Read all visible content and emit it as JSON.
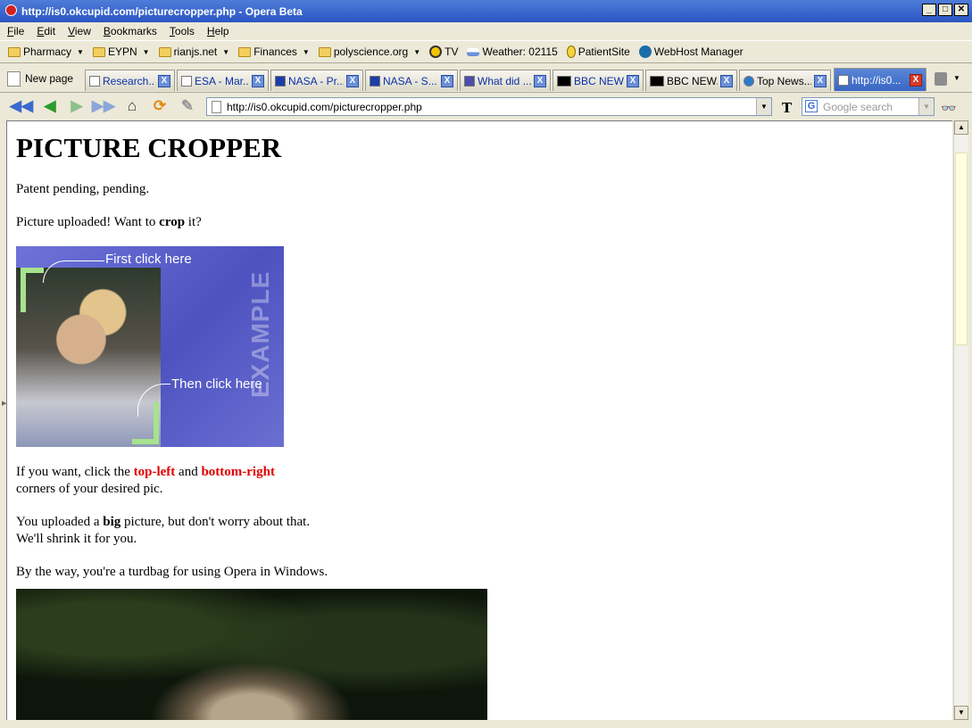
{
  "window": {
    "title": "http://is0.okcupid.com/picturecropper.php - Opera Beta",
    "buttons": {
      "minimize": "_",
      "maximize": "□",
      "close": "✕"
    }
  },
  "menu": [
    "File",
    "Edit",
    "View",
    "Bookmarks",
    "Tools",
    "Help"
  ],
  "bookmarks": [
    {
      "label": "Pharmacy",
      "type": "folder",
      "dropdown": true
    },
    {
      "label": "EYPN",
      "type": "folder",
      "dropdown": true
    },
    {
      "label": "rianjs.net",
      "type": "folder",
      "dropdown": true
    },
    {
      "label": "Finances",
      "type": "folder",
      "dropdown": true
    },
    {
      "label": "polyscience.org",
      "type": "folder",
      "dropdown": true
    },
    {
      "label": "TV",
      "type": "link",
      "icon": "tv-icon"
    },
    {
      "label": "Weather: 02115",
      "type": "link",
      "icon": "weather-icon"
    },
    {
      "label": "PatientSite",
      "type": "link",
      "icon": "lightbulb-icon"
    },
    {
      "label": "WebHost Manager",
      "type": "link",
      "icon": "cpanel-icon"
    }
  ],
  "new_page_label": "New page",
  "tabs": [
    {
      "label": "Research...",
      "active": false
    },
    {
      "label": "ESA - Mar...",
      "active": false
    },
    {
      "label": "NASA - Pr...",
      "active": false
    },
    {
      "label": "NASA - S...",
      "active": false
    },
    {
      "label": "What did ...",
      "active": false
    },
    {
      "label": "BBC NEW...",
      "active": false
    },
    {
      "label": "BBC NEW...",
      "active": false
    },
    {
      "label": "Top News...",
      "active": false
    },
    {
      "label": "http://is0...",
      "active": true
    }
  ],
  "tab_close_glyph": "X",
  "nav": {
    "address": "http://is0.okcupid.com/picturecropper.php",
    "search_placeholder": "Google search",
    "search_engine_glyph": "G",
    "nyt_glyph": "T"
  },
  "page": {
    "heading": "PICTURE CROPPER",
    "subtitle": "Patent pending, pending.",
    "uploaded_pre": "Picture uploaded! Want to ",
    "uploaded_bold": "crop",
    "uploaded_post": " it?",
    "example": {
      "first_click": "First click here",
      "then_click": "Then click here",
      "watermark": "EXAMPLE"
    },
    "instr_pre": "If you want, click the ",
    "instr_tl": "top-left",
    "instr_and": " and ",
    "instr_br": "bottom-right",
    "instr_line2": "corners of your desired pic.",
    "big_pre": "You uploaded a ",
    "big_bold": "big",
    "big_post": " picture, but don't worry about that.",
    "big_line2": "We'll shrink it for you.",
    "opera_note": "By the way, you're a turdbag for using Opera in Windows."
  },
  "colors": {
    "titlebar": "#2a55c4",
    "active_tab": "#3866c2",
    "highlight_red": "#e00000",
    "bracket_green": "#a7e28e",
    "example_bg": "#5a5fc8"
  }
}
